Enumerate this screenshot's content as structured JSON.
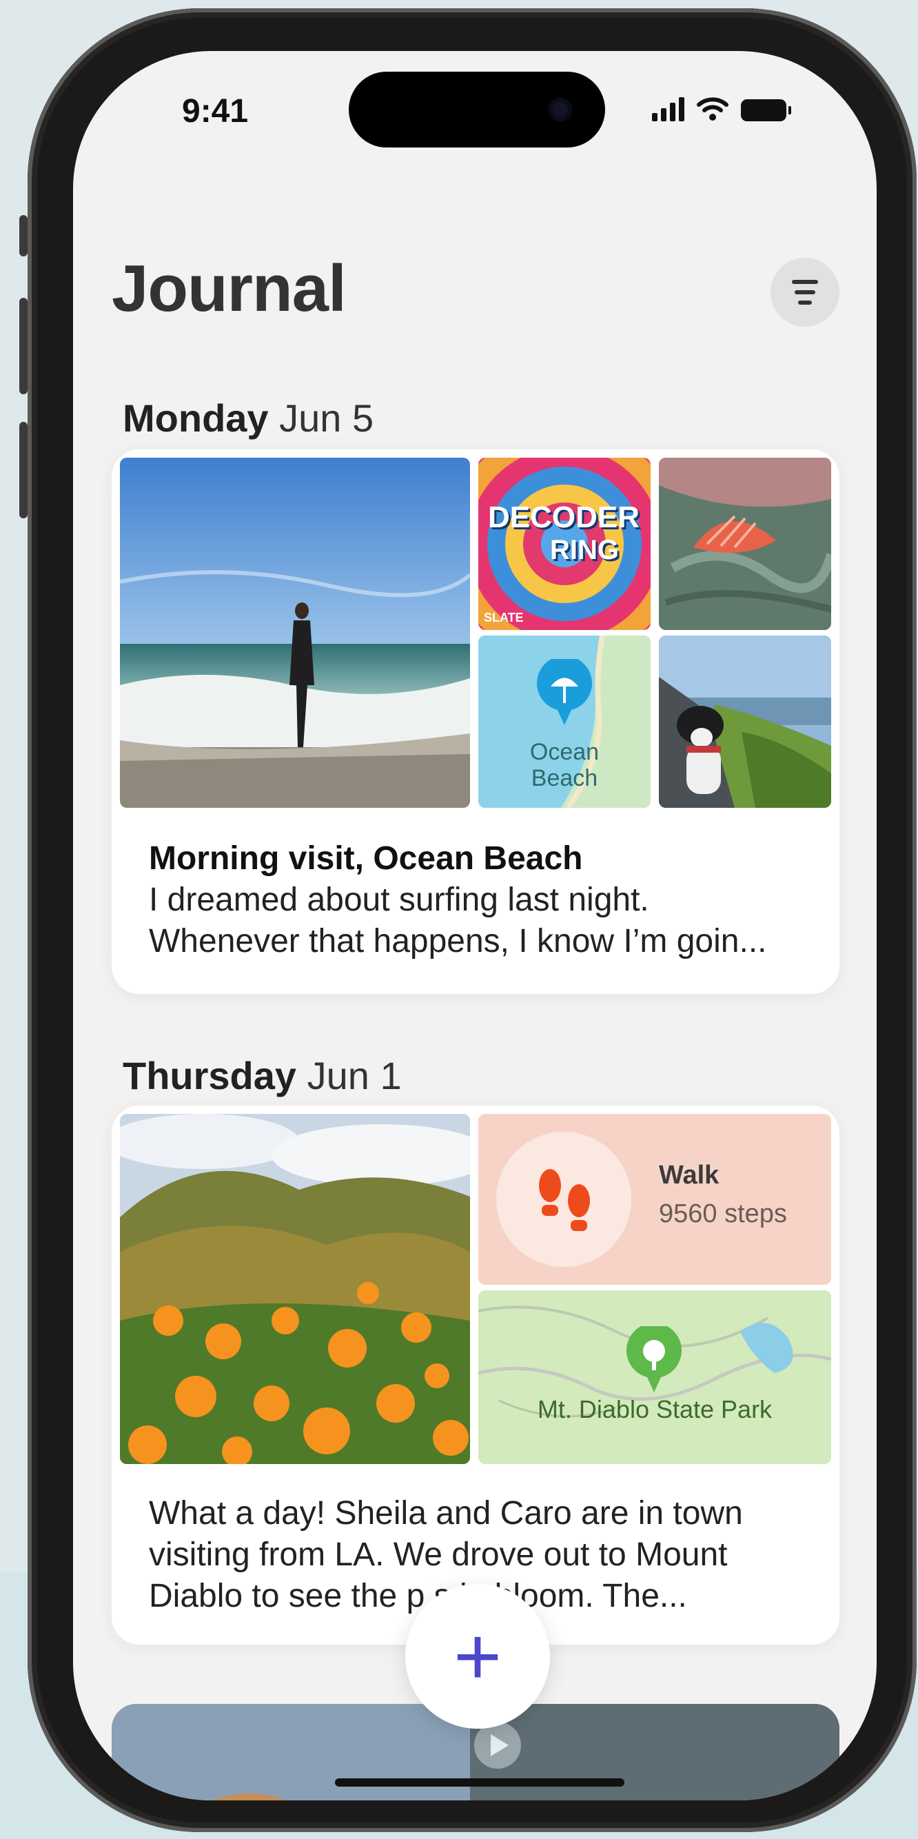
{
  "status_bar": {
    "time": "9:41"
  },
  "header": {
    "title": "Journal",
    "filter_icon": "filter-lines-icon"
  },
  "entries": [
    {
      "date_day": "Monday",
      "date_rest": " Jun 5",
      "title": "Morning visit, Ocean Beach",
      "text": "I dreamed about surfing last night.\nWhenever that happens, I know I’m goin...",
      "podcast": {
        "name_line1": "DECODER",
        "name_line2": "RING",
        "publisher": "SLATE"
      },
      "place": {
        "label_line1": "Ocean",
        "label_line2": "Beach"
      }
    },
    {
      "date_day": "Thursday",
      "date_rest": " Jun 1",
      "text": "What a day! Sheila and Caro are in town\nvisiting from LA. We drove out to Mount\nDiablo to see the p     s in bloom. The...",
      "workout": {
        "title": "Walk",
        "steps": "9560 steps"
      },
      "place": {
        "label": "Mt. Diablo State Park"
      }
    }
  ],
  "fab": {
    "label": "+"
  },
  "colors": {
    "accent": "#4b47c9",
    "workout_bg": "#f7d3c7",
    "map_green": "#5fb84a",
    "map_blue": "#1a9edb"
  }
}
